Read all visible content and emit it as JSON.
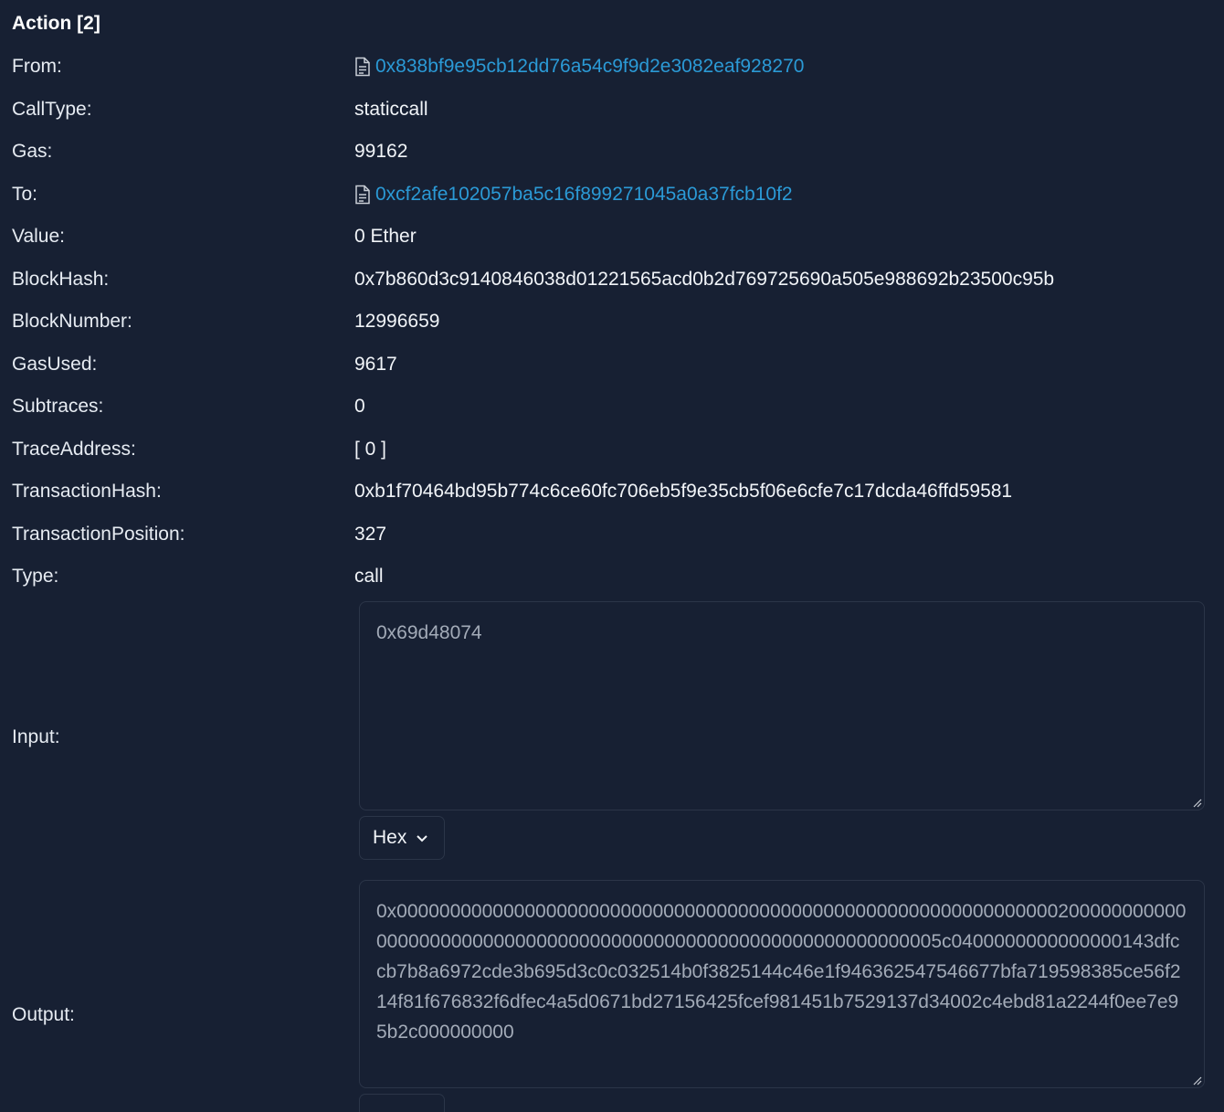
{
  "section": {
    "title": "Action [2]"
  },
  "fields": [
    {
      "label": "From:",
      "value": "0x838bf9e95cb12dd76a54c9f9d2e3082eaf928270",
      "type": "address"
    },
    {
      "label": "CallType:",
      "value": "staticcall",
      "type": "text"
    },
    {
      "label": "Gas:",
      "value": "99162",
      "type": "text"
    },
    {
      "label": "To:",
      "value": "0xcf2afe102057ba5c16f899271045a0a37fcb10f2",
      "type": "address"
    },
    {
      "label": "Value:",
      "value": "0 Ether",
      "type": "text"
    },
    {
      "label": "BlockHash:",
      "value": "0x7b860d3c9140846038d01221565acd0b2d769725690a505e988692b23500c95b",
      "type": "text"
    },
    {
      "label": "BlockNumber:",
      "value": "12996659",
      "type": "text"
    },
    {
      "label": "GasUsed:",
      "value": "9617",
      "type": "text"
    },
    {
      "label": "Subtraces:",
      "value": "0",
      "type": "text"
    },
    {
      "label": "TraceAddress:",
      "value": "[ 0 ]",
      "type": "text"
    },
    {
      "label": "TransactionHash:",
      "value": "0xb1f70464bd95b774c6ce60fc706eb5f9e35cb5f06e6cfe7c17dcda46ffd59581",
      "type": "text"
    },
    {
      "label": "TransactionPosition:",
      "value": "327",
      "type": "text"
    },
    {
      "label": "Type:",
      "value": "call",
      "type": "text"
    }
  ],
  "input": {
    "label": "Input:",
    "value": "0x69d48074",
    "format": "Hex"
  },
  "output": {
    "label": "Output:",
    "value": "0x0000000000000000000000000000000000000000000000000000000000000020000000000000000000000000000000000000000000000000000000000000005c0400000000000000143dfccb7b8a6972cde3b695d3c0c032514b0f3825144c46e1f946362547546677bfa719598385ce56f214f81f676832f6dfec4a5d0671bd27156425fcef981451b7529137d34002c4ebd81a2244f0ee7e95b2c000000000"
  },
  "icons": {
    "address_icon": "document-icon",
    "select_icon": "chevron-down-icon"
  },
  "colors": {
    "background": "#172033",
    "link": "#2b9ad6",
    "muted_text": "#a3abb8",
    "border": "#2b3548"
  }
}
